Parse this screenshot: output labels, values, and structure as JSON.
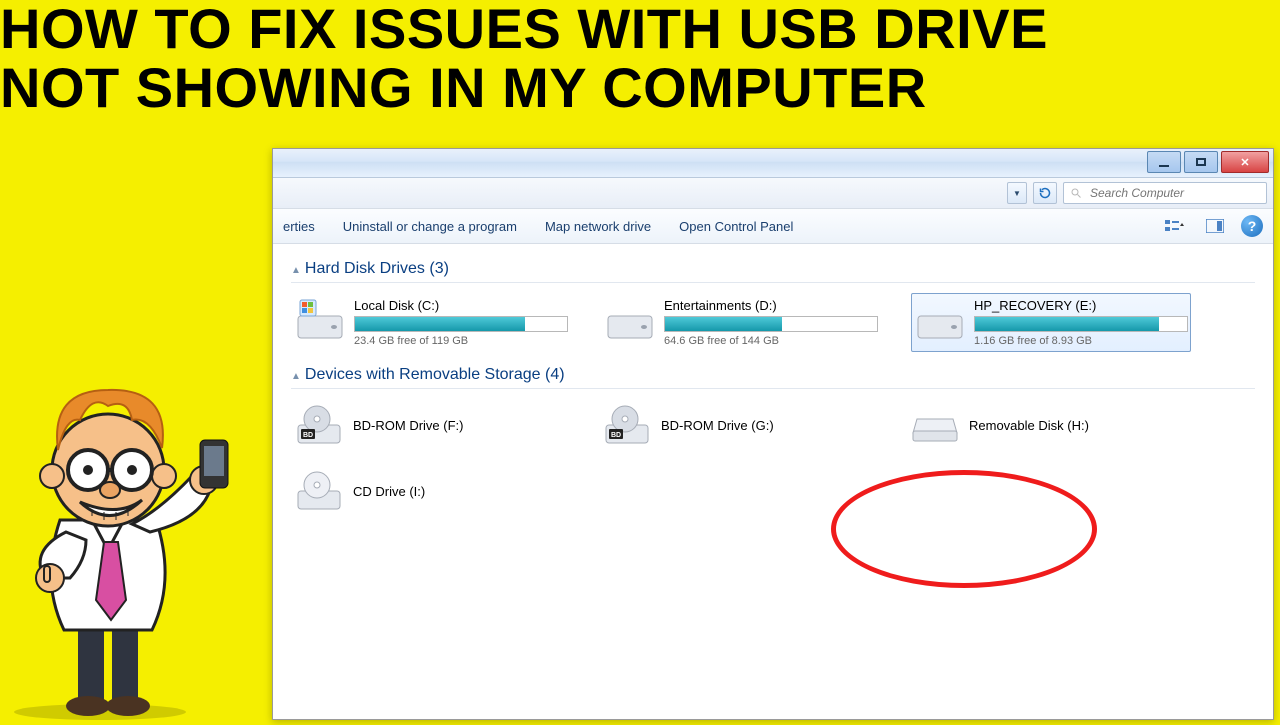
{
  "headline_line1": "HOW TO FIX ISSUES WITH USB DRIVE",
  "headline_line2": "NOT SHOWING IN MY COMPUTER",
  "search_placeholder": "Search Computer",
  "toolbar": {
    "erties": "erties",
    "uninstall": "Uninstall or change a program",
    "map": "Map network drive",
    "cp": "Open Control Panel"
  },
  "groups": {
    "hdd": "Hard Disk Drives (3)",
    "removable": "Devices with Removable Storage (4)"
  },
  "drives": {
    "c": {
      "name": "Local Disk (C:)",
      "free": "23.4 GB free of 119 GB",
      "fill": 80
    },
    "d": {
      "name": "Entertainments (D:)",
      "free": "64.6 GB free of 144 GB",
      "fill": 55
    },
    "e": {
      "name": "HP_RECOVERY (E:)",
      "free": "1.16 GB free of 8.93 GB",
      "fill": 87
    }
  },
  "devices": {
    "f": {
      "name": "BD-ROM Drive (F:)"
    },
    "g": {
      "name": "BD-ROM Drive (G:)"
    },
    "h": {
      "name": "Removable Disk (H:)"
    },
    "i": {
      "name": "CD Drive (I:)"
    }
  }
}
